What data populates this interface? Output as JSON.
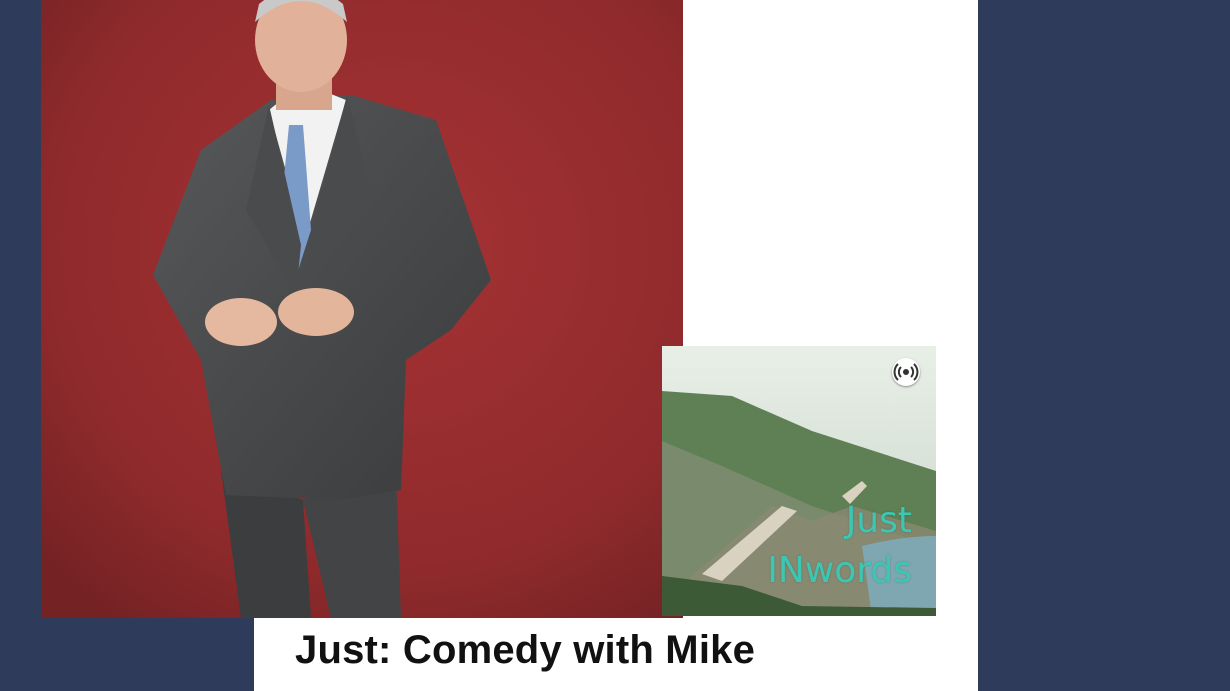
{
  "colors": {
    "page_background": "#2e3b5a",
    "card_background": "#ffffff",
    "hero_backdrop": "#972c2e",
    "cover_text": "#3cc7b5",
    "title_text": "#111111"
  },
  "hero": {
    "alt": "Comedian in grey suit against red backdrop"
  },
  "cover_art": {
    "title_line1": "Just",
    "title_line2": "INwords",
    "badge_icon": "podcast-antenna-icon"
  },
  "episode": {
    "title": "Just: Comedy with Mike"
  }
}
